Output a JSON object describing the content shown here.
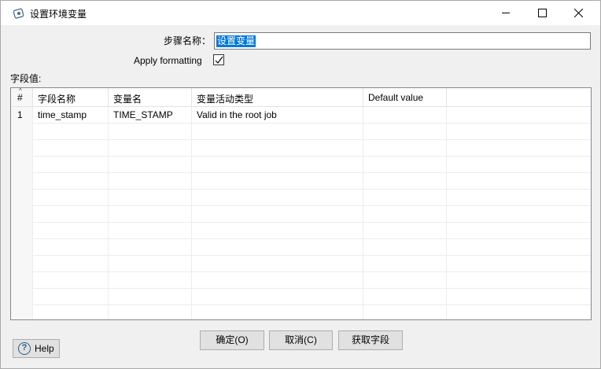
{
  "window": {
    "title": "设置环境变量",
    "controls": [
      "minimize-icon",
      "maximize-icon",
      "close-icon"
    ]
  },
  "form": {
    "step_name_label": "步骤名称：",
    "step_name_value": "设置变量",
    "apply_formatting_label": "Apply formatting",
    "apply_formatting_checked": true,
    "fields_label": "字段值:"
  },
  "table": {
    "columns": [
      "#",
      "字段名称",
      "变量名",
      "变量活动类型",
      "Default value",
      ""
    ],
    "rows": [
      [
        "1",
        "time_stamp",
        "TIME_STAMP",
        "Valid in the root job",
        "",
        ""
      ]
    ]
  },
  "buttons": {
    "ok": "确定(O)",
    "cancel": "取消(C)",
    "get_fields": "获取字段",
    "help": "Help"
  },
  "colors": {
    "selection": "#0078d7",
    "dialog_bg": "#f0f0f0",
    "button_bg": "#e1e1e1"
  }
}
